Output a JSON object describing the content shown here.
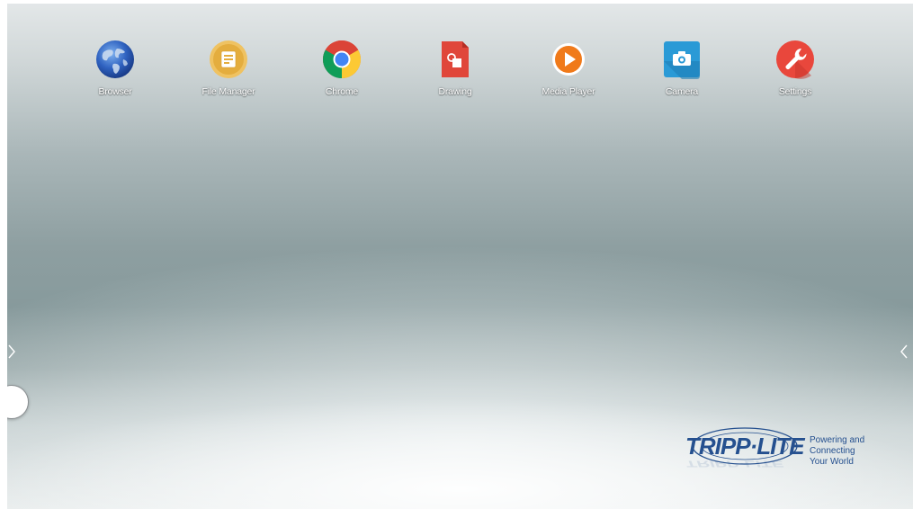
{
  "apps": [
    {
      "label": "Browser",
      "icon": "globe-icon",
      "color": "#3e6fc4"
    },
    {
      "label": "File Manager",
      "icon": "folder-icon",
      "color": "#e8b94b"
    },
    {
      "label": "Chrome",
      "icon": "chrome-icon",
      "color": "#db4437"
    },
    {
      "label": "Drawing",
      "icon": "drawing-icon",
      "color": "#e0463a"
    },
    {
      "label": "Media Player",
      "icon": "play-icon",
      "color": "#f07a1a"
    },
    {
      "label": "Camera",
      "icon": "camera-icon",
      "color": "#2a9ad6"
    },
    {
      "label": "Settings",
      "icon": "wrench-icon",
      "color": "#e9473c"
    }
  ],
  "side_controls": {
    "left_arrow_icon": "chevron-right-icon",
    "right_arrow_icon": "chevron-left-icon",
    "floating_button_icon": "assistive-ball-icon"
  },
  "brand": {
    "logo_text": "TRIPP·LITE",
    "tagline_lines": [
      "Powering and",
      "Connecting",
      "Your World"
    ],
    "color": "#25508f"
  }
}
